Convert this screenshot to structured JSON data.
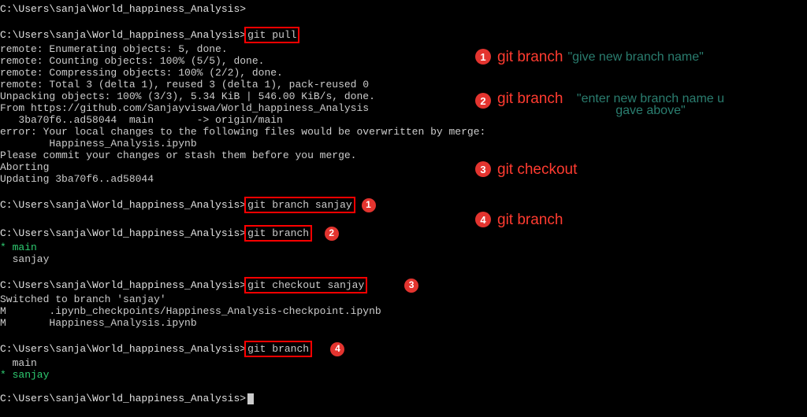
{
  "prompt": "C:\\Users\\sanja\\World_happiness_Analysis>",
  "cmd": {
    "pull": "git pull",
    "branch_create": "git branch sanjay",
    "branch_list1": "git branch",
    "checkout": "git checkout sanjay",
    "branch_list2": "git branch"
  },
  "out": {
    "l1": "remote: Enumerating objects: 5, done.",
    "l2": "remote: Counting objects: 100% (5/5), done.",
    "l3": "remote: Compressing objects: 100% (2/2), done.",
    "l4": "remote: Total 3 (delta 1), reused 3 (delta 1), pack-reused 0",
    "l5": "Unpacking objects: 100% (3/3), 5.34 KiB | 546.00 KiB/s, done.",
    "l6": "From https://github.com/Sanjayviswa/World_happiness_Analysis",
    "l7": "   3ba70f6..ad58044  main       -> origin/main",
    "l8": "error: Your local changes to the following files would be overwritten by merge:",
    "l9": "        Happiness_Analysis.ipynb",
    "l10": "Please commit your changes or stash them before you merge.",
    "l11": "Aborting",
    "l12": "Updating 3ba70f6..ad58044",
    "main_star": "* main",
    "sanjay_plain": "  sanjay",
    "switched": "Switched to branch 'sanjay'",
    "m1": "M       .ipynb_checkpoints/Happiness_Analysis-checkpoint.ipynb",
    "m2": "M       Happiness_Analysis.ipynb",
    "main_plain": "  main",
    "sanjay_star": "* sanjay"
  },
  "annotations": {
    "a1": {
      "n": "1",
      "label": "git branch",
      "hint": "\"give new branch name\""
    },
    "a2": {
      "n": "2",
      "label": "git branch",
      "hint": "\"enter new branch name u gave above\""
    },
    "a3": {
      "n": "3",
      "label": "git checkout"
    },
    "a4": {
      "n": "4",
      "label": "git branch"
    }
  },
  "inline_badges": {
    "b1": "1",
    "b2": "2",
    "b3": "3",
    "b4": "4"
  }
}
